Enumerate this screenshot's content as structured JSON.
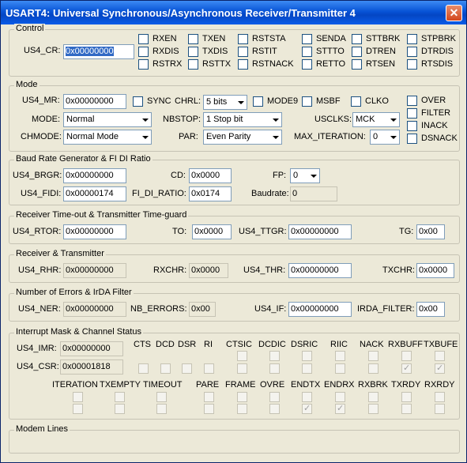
{
  "window": {
    "title": "USART4: Universal Synchronous/Asynchronous Receiver/Transmitter 4",
    "close": "✕"
  },
  "control": {
    "title": "Control",
    "cr_label": "US4_CR:",
    "cr_value": "0x00000000",
    "bits": [
      "RXEN",
      "TXEN",
      "RSTSTA",
      "SENDA",
      "STTBRK",
      "STPBRK",
      "RXDIS",
      "TXDIS",
      "RSTIT",
      "STTTO",
      "DTREN",
      "DTRDIS",
      "RSTRX",
      "RSTTX",
      "RSTNACK",
      "RETTO",
      "RTSEN",
      "RTSDIS"
    ]
  },
  "mode": {
    "title": "Mode",
    "mr_label": "US4_MR:",
    "mr_value": "0x00000000",
    "sync": "SYNC",
    "chrl_label": "CHRL:",
    "chrl_value": "5 bits",
    "mode9": "MODE9",
    "msbf": "MSBF",
    "clko": "CLKO",
    "mode_label": "MODE:",
    "mode_value": "Normal",
    "nbstop_label": "NBSTOP:",
    "nbstop_value": "1 Stop bit",
    "usclks_label": "USCLKS:",
    "usclks_value": "MCK",
    "chmode_label": "CHMODE:",
    "chmode_value": "Normal Mode",
    "par_label": "PAR:",
    "par_value": "Even Parity",
    "maxit_label": "MAX_ITERATION:",
    "maxit_value": "0",
    "flags": [
      "OVER",
      "FILTER",
      "INACK",
      "DSNACK"
    ]
  },
  "baud": {
    "title": "Baud Rate Generator & FI DI Ratio",
    "brgr_label": "US4_BRGR:",
    "brgr_value": "0x00000000",
    "cd_label": "CD:",
    "cd_value": "0x0000",
    "fp_label": "FP:",
    "fp_value": "0",
    "fidi_label": "US4_FIDI:",
    "fidi_value": "0x00000174",
    "ratio_label": "FI_DI_RATIO:",
    "ratio_value": "0x0174",
    "baud_label": "Baudrate:",
    "baud_value": "0"
  },
  "timeout": {
    "title": "Receiver Time-out & Transmitter Time-guard",
    "rtor_label": "US4_RTOR:",
    "rtor_value": "0x00000000",
    "to_label": "TO:",
    "to_value": "0x0000",
    "ttgr_label": "US4_TTGR:",
    "ttgr_value": "0x00000000",
    "tg_label": "TG:",
    "tg_value": "0x00"
  },
  "rxtx": {
    "title": "Receiver & Transmitter",
    "rhr_label": "US4_RHR:",
    "rhr_value": "0x00000000",
    "rxchr_label": "RXCHR:",
    "rxchr_value": "0x0000",
    "thr_label": "US4_THR:",
    "thr_value": "0x00000000",
    "txchr_label": "TXCHR:",
    "txchr_value": "0x0000"
  },
  "errors": {
    "title": "Number of Errors & IrDA Filter",
    "ner_label": "US4_NER:",
    "ner_value": "0x00000000",
    "nb_label": "NB_ERRORS:",
    "nb_value": "0x00",
    "if_label": "US4_IF:",
    "if_value": "0x00000000",
    "irda_label": "IRDA_FILTER:",
    "irda_value": "0x00"
  },
  "interrupt": {
    "title": "Interrupt Mask & Channel Status",
    "imr_label": "US4_IMR:",
    "imr_value": "0x00000000",
    "csr_label": "US4_CSR:",
    "csr_value": "0x00001818",
    "row1": [
      "CTS",
      "DCD",
      "DSR",
      "RI",
      "CTSIC",
      "DCDIC",
      "DSRIC",
      "RIIC",
      "NACK",
      "RXBUFF",
      "TXBUFE"
    ],
    "row2": [
      "ITERATION",
      "TXEMPTY",
      "TIMEOUT",
      "PARE",
      "FRAME",
      "OVRE",
      "ENDTX",
      "ENDRX",
      "RXBRK",
      "TXRDY",
      "RXRDY"
    ]
  },
  "modem": {
    "title": "Modem Lines"
  }
}
